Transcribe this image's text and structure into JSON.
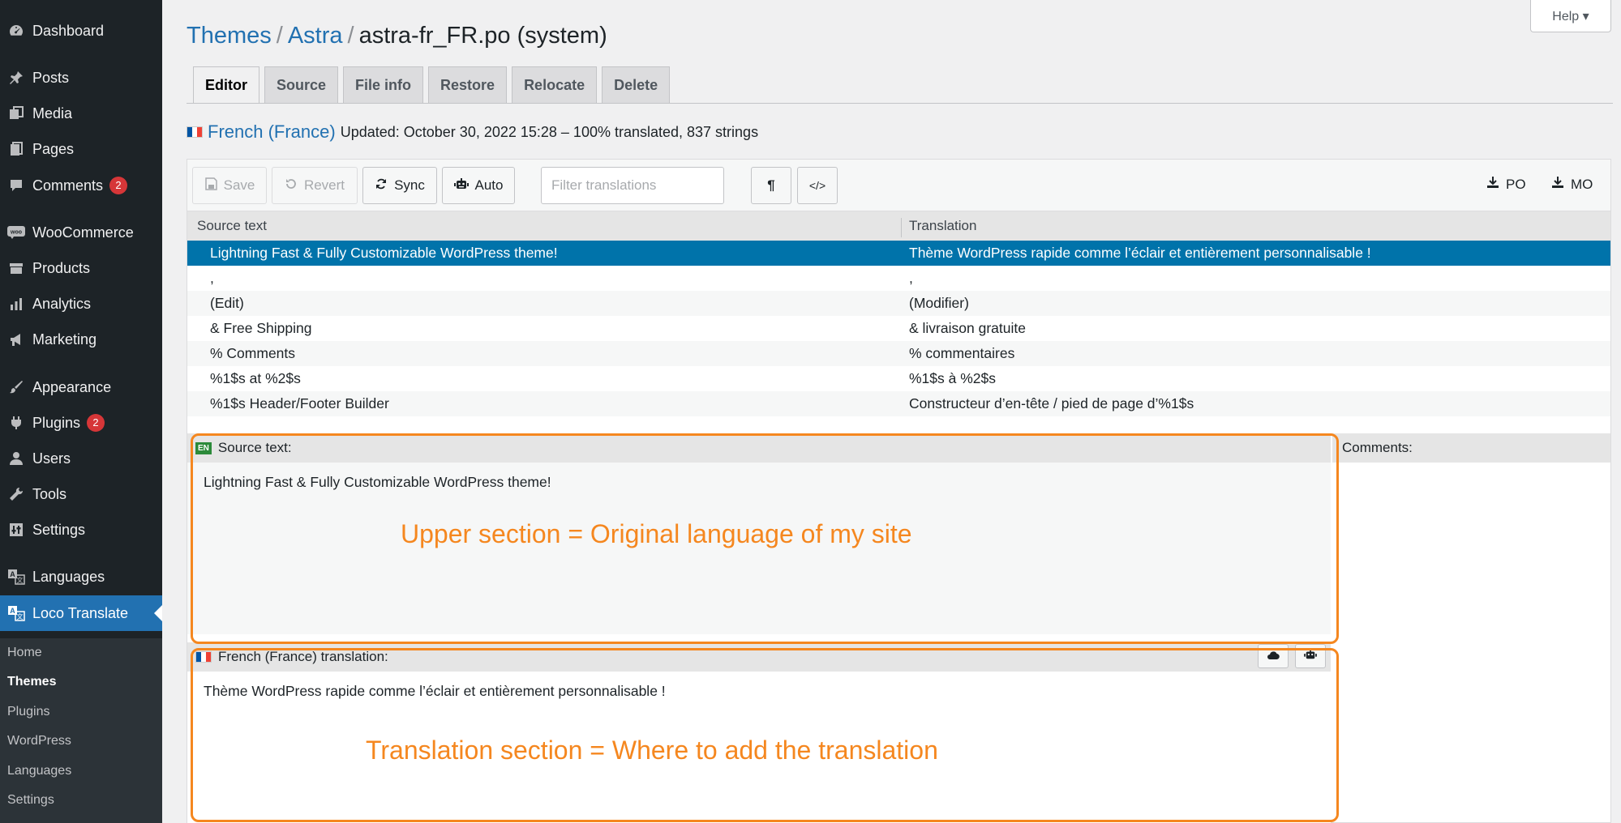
{
  "sidebar": {
    "items": [
      {
        "label": "Dashboard",
        "icon": "dashboard-icon"
      },
      {
        "label": "Posts",
        "icon": "pin-icon"
      },
      {
        "label": "Media",
        "icon": "media-icon"
      },
      {
        "label": "Pages",
        "icon": "pages-icon"
      },
      {
        "label": "Comments",
        "icon": "comment-icon",
        "badge": "2"
      },
      {
        "label": "WooCommerce",
        "icon": "woo-icon"
      },
      {
        "label": "Products",
        "icon": "archive-icon"
      },
      {
        "label": "Analytics",
        "icon": "bar-chart-icon"
      },
      {
        "label": "Marketing",
        "icon": "megaphone-icon"
      },
      {
        "label": "Appearance",
        "icon": "brush-icon"
      },
      {
        "label": "Plugins",
        "icon": "plugin-icon",
        "badge": "2"
      },
      {
        "label": "Users",
        "icon": "user-icon"
      },
      {
        "label": "Tools",
        "icon": "wrench-icon"
      },
      {
        "label": "Settings",
        "icon": "settings-icon"
      },
      {
        "label": "Languages",
        "icon": "translate-icon"
      },
      {
        "label": "Loco Translate",
        "icon": "translate-icon"
      }
    ],
    "submenu": [
      "Home",
      "Themes",
      "Plugins",
      "WordPress",
      "Languages",
      "Settings"
    ]
  },
  "header": {
    "help_label": "Help ▾",
    "crumb1": "Themes",
    "crumb2": "Astra",
    "crumb3": "astra-fr_FR.po (system)",
    "sep": "/"
  },
  "tabs": [
    "Editor",
    "Source",
    "File info",
    "Restore",
    "Relocate",
    "Delete"
  ],
  "status": {
    "language": "French (France)",
    "text": "Updated: October 30, 2022 15:28 – 100% translated, 837 strings"
  },
  "toolbar": {
    "save": "Save",
    "revert": "Revert",
    "sync": "Sync",
    "auto": "Auto",
    "filter_placeholder": "Filter translations",
    "pilcrow": "¶",
    "code": "</>",
    "po": "PO",
    "mo": "MO"
  },
  "grid": {
    "source_header": "Source text",
    "translation_header": "Translation",
    "rows": [
      {
        "source": "Lightning Fast & Fully Customizable WordPress theme!",
        "translation": "Thème WordPress rapide comme l’éclair et entièrement personnalisable !"
      },
      {
        "source": ",",
        "translation": ","
      },
      {
        "source": "(Edit)",
        "translation": "(Modifier)"
      },
      {
        "source": "& Free Shipping",
        "translation": "& livraison gratuite"
      },
      {
        "source": "% Comments",
        "translation": "% commentaires"
      },
      {
        "source": "%1$s at %2$s",
        "translation": "%1$s à %2$s"
      },
      {
        "source": "%1$s Header/Footer Builder",
        "translation": "Constructeur d’en-tête / pied de page d’%1$s"
      }
    ]
  },
  "source_pane": {
    "badge": "EN",
    "label": "Source text:",
    "text": "Lightning Fast & Fully Customizable WordPress theme!",
    "annotation": "Upper section =  Original language of my site"
  },
  "comments_label": "Comments:",
  "translation_pane": {
    "label": "French (France) translation:",
    "text": "Thème WordPress rapide comme l’éclair et entièrement personnalisable !",
    "annotation": "Translation section =  Where to add the translation"
  },
  "colors": {
    "sidebar_bg": "#1d2327",
    "accent": "#2271b1",
    "selected_row": "#0073aa",
    "highlight": "#f5871f",
    "badge": "#d63638"
  }
}
